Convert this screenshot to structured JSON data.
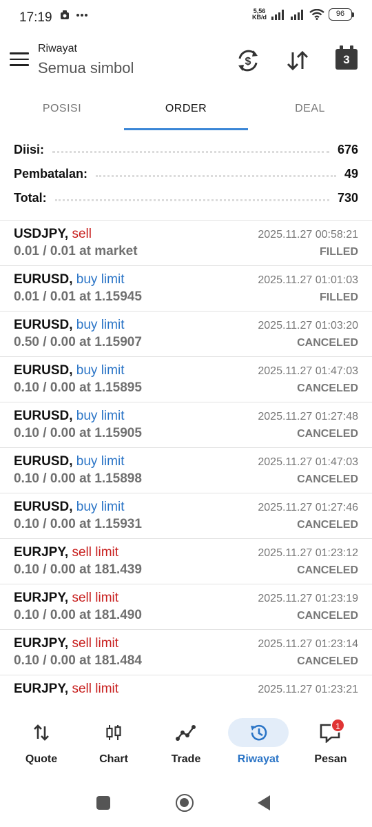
{
  "status_bar": {
    "time": "17:19",
    "net_speed_value": "5,56",
    "net_speed_unit": "KB/d",
    "battery": "96"
  },
  "header": {
    "title": "Riwayat",
    "subtitle": "Semua simbol",
    "calendar_day": "3"
  },
  "tabs": [
    {
      "label": "POSISI",
      "active": false
    },
    {
      "label": "ORDER",
      "active": true
    },
    {
      "label": "DEAL",
      "active": false
    }
  ],
  "summary": {
    "filled_label": "Diisi:",
    "filled_value": "676",
    "canceled_label": "Pembatalan:",
    "canceled_value": "49",
    "total_label": "Total:",
    "total_value": "730"
  },
  "orders": [
    {
      "symbol": "USDJPY,",
      "type": "sell",
      "side": "sell",
      "detail": "0.01 / 0.01 at market",
      "time": "2025.11.27 00:58:21",
      "status": "FILLED"
    },
    {
      "symbol": "EURUSD,",
      "type": "buy limit",
      "side": "buy",
      "detail": "0.01 / 0.01 at 1.15945",
      "time": "2025.11.27 01:01:03",
      "status": "FILLED"
    },
    {
      "symbol": "EURUSD,",
      "type": "buy limit",
      "side": "buy",
      "detail": "0.50 / 0.00 at 1.15907",
      "time": "2025.11.27 01:03:20",
      "status": "CANCELED"
    },
    {
      "symbol": "EURUSD,",
      "type": "buy limit",
      "side": "buy",
      "detail": "0.10 / 0.00 at 1.15895",
      "time": "2025.11.27 01:47:03",
      "status": "CANCELED"
    },
    {
      "symbol": "EURUSD,",
      "type": "buy limit",
      "side": "buy",
      "detail": "0.10 / 0.00 at 1.15905",
      "time": "2025.11.27 01:27:48",
      "status": "CANCELED"
    },
    {
      "symbol": "EURUSD,",
      "type": "buy limit",
      "side": "buy",
      "detail": "0.10 / 0.00 at 1.15898",
      "time": "2025.11.27 01:47:03",
      "status": "CANCELED"
    },
    {
      "symbol": "EURUSD,",
      "type": "buy limit",
      "side": "buy",
      "detail": "0.10 / 0.00 at 1.15931",
      "time": "2025.11.27 01:27:46",
      "status": "CANCELED"
    },
    {
      "symbol": "EURJPY,",
      "type": "sell limit",
      "side": "sell",
      "detail": "0.10 / 0.00 at 181.439",
      "time": "2025.11.27 01:23:12",
      "status": "CANCELED"
    },
    {
      "symbol": "EURJPY,",
      "type": "sell limit",
      "side": "sell",
      "detail": "0.10 / 0.00 at 181.490",
      "time": "2025.11.27 01:23:19",
      "status": "CANCELED"
    },
    {
      "symbol": "EURJPY,",
      "type": "sell limit",
      "side": "sell",
      "detail": "0.10 / 0.00 at 181.484",
      "time": "2025.11.27 01:23:14",
      "status": "CANCELED"
    },
    {
      "symbol": "EURJPY,",
      "type": "sell limit",
      "side": "sell",
      "detail": "",
      "time": "2025.11.27 01:23:21",
      "status": ""
    }
  ],
  "bottom_nav": [
    {
      "label": "Quote",
      "icon": "quote-arrows-icon",
      "active": false
    },
    {
      "label": "Chart",
      "icon": "candlestick-icon",
      "active": false
    },
    {
      "label": "Trade",
      "icon": "trade-line-icon",
      "active": false
    },
    {
      "label": "Riwayat",
      "icon": "history-icon",
      "active": true
    },
    {
      "label": "Pesan",
      "icon": "message-icon",
      "active": false
    }
  ],
  "message_badge": "1",
  "colors": {
    "accent": "#3b86d6",
    "sell": "#c8201f",
    "buy": "#2a74c6",
    "active_nav_bg": "#e3edf9",
    "badge": "#e03434"
  }
}
